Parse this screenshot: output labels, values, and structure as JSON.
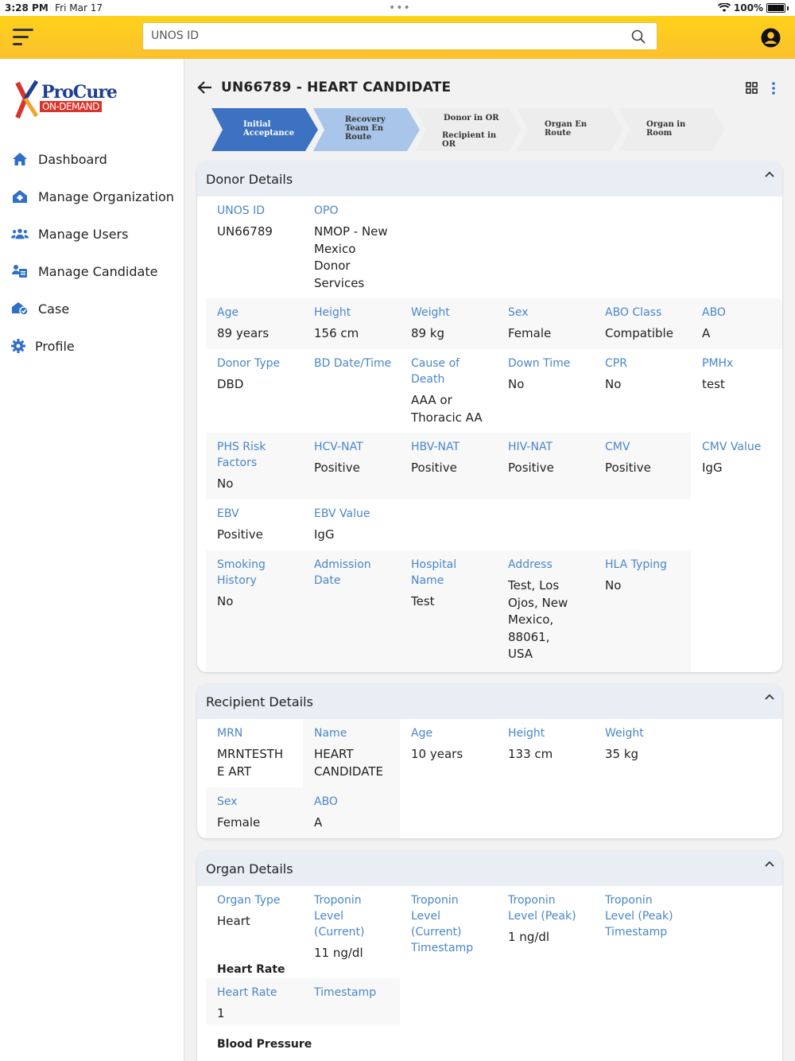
{
  "status": {
    "time": "3:28 PM",
    "date": "Fri Mar 17",
    "battery": "100%"
  },
  "header": {
    "search_placeholder": "UNOS ID"
  },
  "sidebar": {
    "logo_line1": "ProCure",
    "logo_line2": "ON-DEMAND",
    "items": [
      {
        "label": "Dashboard",
        "icon": "home-icon"
      },
      {
        "label": "Manage Organization",
        "icon": "organization-icon"
      },
      {
        "label": "Manage Users",
        "icon": "users-icon"
      },
      {
        "label": "Manage Candidate",
        "icon": "candidate-icon"
      },
      {
        "label": "Case",
        "icon": "case-icon"
      },
      {
        "label": "Profile",
        "icon": "gear-icon"
      }
    ]
  },
  "page": {
    "title": "UN66789 - HEART CANDIDATE"
  },
  "stepper": {
    "steps": [
      {
        "line1": "Initial",
        "line2": "Acceptance",
        "line3": ""
      },
      {
        "line1": "Recovery",
        "line2": "Team En",
        "line3": "Route"
      },
      {
        "line1": "Donor in OR",
        "line2": "Recipient in",
        "line3": "OR"
      },
      {
        "line1": "Organ En",
        "line2": "Route",
        "line3": ""
      },
      {
        "line1": "Organ in",
        "line2": "Room",
        "line3": ""
      }
    ]
  },
  "donor": {
    "title": "Donor Details",
    "unos_id_label": "UNOS ID",
    "unos_id": "UN66789",
    "opo_label": "OPO",
    "opo": "NMOP - New Mexico Donor Services",
    "age_label": "Age",
    "age": "89 years",
    "height_label": "Height",
    "height": "156 cm",
    "weight_label": "Weight",
    "weight": "89 kg",
    "sex_label": "Sex",
    "sex": "Female",
    "abo_class_label": "ABO Class",
    "abo_class": "Compatible",
    "abo_label": "ABO",
    "abo": "A",
    "donor_type_label": "Donor Type",
    "donor_type": "DBD",
    "bd_label": "BD Date/Time",
    "bd": "",
    "cause_label": "Cause of Death",
    "cause": "AAA or Thoracic AA",
    "down_label": "Down Time",
    "down": "No",
    "cpr_label": "CPR",
    "cpr": "No",
    "pmhx_label": "PMHx",
    "pmhx": "test",
    "phs_label": "PHS Risk Factors",
    "phs": "No",
    "hcv_label": "HCV-NAT",
    "hcv": "Positive",
    "hbv_label": "HBV-NAT",
    "hbv": "Positive",
    "hiv_label": "HIV-NAT",
    "hiv": "Positive",
    "cmv_label": "CMV",
    "cmv": "Positive",
    "cmv_value_label": "CMV Value",
    "cmv_value": "IgG",
    "ebv_label": "EBV",
    "ebv": "Positive",
    "ebv_value_label": "EBV Value",
    "ebv_value": "IgG",
    "smoking_label": "Smoking History",
    "smoking": "No",
    "admission_label": "Admission Date",
    "admission": "",
    "hospital_label": "Hospital Name",
    "hospital": "Test",
    "address_label": "Address",
    "address": "Test, Los Ojos, New Mexico, 88061, USA",
    "hla_label": "HLA Typing",
    "hla": "No"
  },
  "recipient": {
    "title": "Recipient Details",
    "mrn_label": "MRN",
    "mrn": "MRNTESTHE ART",
    "name_label": "Name",
    "name": "HEART CANDIDATE",
    "age_label": "Age",
    "age": "10 years",
    "height_label": "Height",
    "height": "133 cm",
    "weight_label": "Weight",
    "weight": "35 kg",
    "sex_label": "Sex",
    "sex": "Female",
    "abo_label": "ABO",
    "abo": "A"
  },
  "organ": {
    "title": "Organ Details",
    "type_label": "Organ Type",
    "type": "Heart",
    "trop_current_label": "Troponin Level (Current)",
    "trop_current": "11 ng/dl",
    "trop_current_ts_label": "Troponin Level (Current) Timestamp",
    "trop_current_ts": "",
    "trop_peak_label": "Troponin Level (Peak)",
    "trop_peak": "1 ng/dl",
    "trop_peak_ts_label": "Troponin Level (Peak) Timestamp",
    "trop_peak_ts": "",
    "heart_rate_section": "Heart Rate",
    "hr_label": "Heart Rate",
    "hr": "1",
    "hr_ts_label": "Timestamp",
    "hr_ts": "",
    "bp_section": "Blood Pressure"
  },
  "colors": {
    "header_yellow": "#fbc02d",
    "step_active": "#3d72c2",
    "step_next": "#a9c5ea",
    "label_blue": "#4a86c8"
  }
}
